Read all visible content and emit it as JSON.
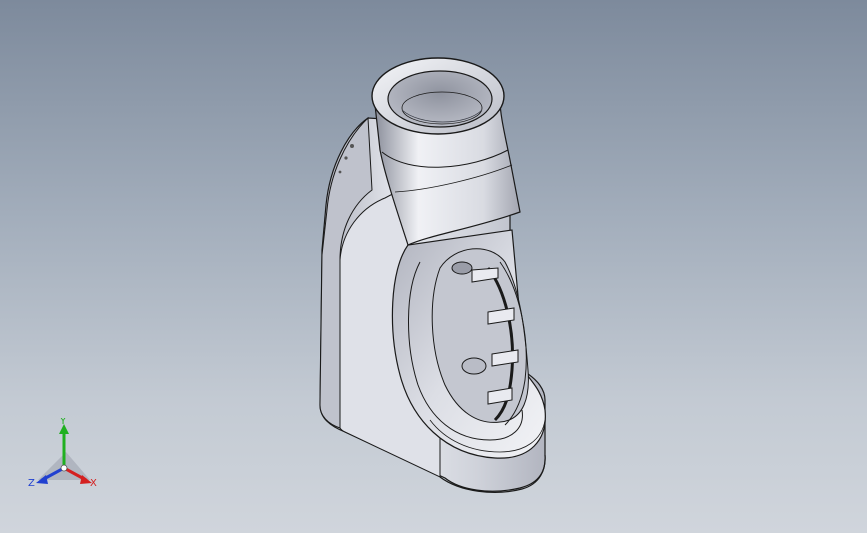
{
  "viewport": {
    "colors": {
      "background_top": "#7d8a9c",
      "background_bottom": "#d0d5dc",
      "part_body": "#d4d6df",
      "part_edge": "#1a1a1a"
    }
  },
  "triad": {
    "x_label": "X",
    "y_label": "Y",
    "z_label": "Z",
    "colors": {
      "x": "#d42020",
      "y": "#20b020",
      "z": "#2040d0"
    }
  }
}
